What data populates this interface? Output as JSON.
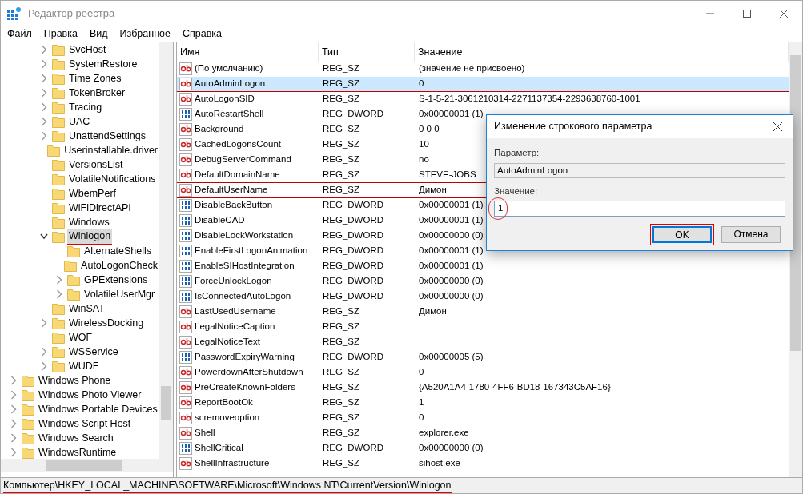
{
  "window": {
    "title": "Редактор реестра"
  },
  "menu": [
    "Файл",
    "Правка",
    "Вид",
    "Избранное",
    "Справка"
  ],
  "tree": {
    "items": [
      {
        "children": [
          {
            "children": [
              {
                "label": "SvcHost",
                "expandable": true,
                "expanded": false,
                "selected": false,
                "underlined": false
              },
              {
                "label": "SystemRestore",
                "expandable": true,
                "expanded": false,
                "selected": false,
                "underlined": false
              },
              {
                "label": "Time Zones",
                "expandable": true,
                "expanded": false,
                "selected": false,
                "underlined": false
              },
              {
                "label": "TokenBroker",
                "expandable": true,
                "expanded": false,
                "selected": false,
                "underlined": false
              },
              {
                "label": "Tracing",
                "expandable": true,
                "expanded": false,
                "selected": false,
                "underlined": false
              },
              {
                "label": "UAC",
                "expandable": true,
                "expanded": false,
                "selected": false,
                "underlined": false
              },
              {
                "label": "UnattendSettings",
                "expandable": true,
                "expanded": false,
                "selected": false,
                "underlined": false
              },
              {
                "label": "Userinstallable.driver",
                "expandable": false,
                "selected": false,
                "underlined": false
              },
              {
                "label": "VersionsList",
                "expandable": false,
                "selected": false,
                "underlined": false
              },
              {
                "label": "VolatileNotifications",
                "expandable": false,
                "selected": false,
                "underlined": false
              },
              {
                "label": "WbemPerf",
                "expandable": false,
                "selected": false,
                "underlined": false
              },
              {
                "label": "WiFiDirectAPI",
                "expandable": false,
                "selected": false,
                "underlined": false
              },
              {
                "label": "Windows",
                "expandable": false,
                "selected": false,
                "underlined": false
              },
              {
                "label": "Winlogon",
                "expandable": true,
                "expanded": true,
                "selected": true,
                "underlined": true,
                "children": [
                  {
                    "label": "AlternateShells",
                    "expandable": false,
                    "selected": false,
                    "underlined": false
                  },
                  {
                    "label": "AutoLogonCheck",
                    "expandable": false,
                    "selected": false,
                    "underlined": false
                  },
                  {
                    "label": "GPExtensions",
                    "expandable": true,
                    "expanded": false,
                    "selected": false,
                    "underlined": false
                  },
                  {
                    "label": "VolatileUserMgr",
                    "expandable": true,
                    "expanded": false,
                    "selected": false,
                    "underlined": false
                  }
                ]
              },
              {
                "label": "WinSAT",
                "expandable": false,
                "selected": false,
                "underlined": false
              },
              {
                "label": "WirelessDocking",
                "expandable": true,
                "expanded": false,
                "selected": false,
                "underlined": false
              },
              {
                "label": "WOF",
                "expandable": false,
                "selected": false,
                "underlined": false
              },
              {
                "label": "WSService",
                "expandable": true,
                "expanded": false,
                "selected": false,
                "underlined": false
              },
              {
                "label": "WUDF",
                "expandable": true,
                "expanded": false,
                "selected": false,
                "underlined": false
              }
            ]
          }
        ]
      },
      {
        "label": "Windows Phone",
        "expandable": true,
        "expanded": false,
        "selected": false,
        "underlined": false
      },
      {
        "label": "Windows Photo Viewer",
        "expandable": true,
        "expanded": false,
        "selected": false,
        "underlined": false
      },
      {
        "label": "Windows Portable Devices",
        "expandable": true,
        "expanded": false,
        "selected": false,
        "underlined": false
      },
      {
        "label": "Windows Script Host",
        "expandable": true,
        "expanded": false,
        "selected": false,
        "underlined": false
      },
      {
        "label": "Windows Search",
        "expandable": true,
        "expanded": false,
        "selected": false,
        "underlined": false
      },
      {
        "label": "WindowsRuntime",
        "expandable": true,
        "expanded": false,
        "selected": false,
        "underlined": false
      }
    ]
  },
  "table": {
    "columns": [
      "Имя",
      "Тип",
      "Значение"
    ],
    "rows": [
      {
        "kind": "string",
        "name": "(По умолчанию)",
        "type": "REG_SZ",
        "value": "(значение не присвоено)",
        "selected": false,
        "underlined": false
      },
      {
        "kind": "string",
        "name": "AutoAdminLogon",
        "type": "REG_SZ",
        "value": "0",
        "selected": true,
        "underlined": true
      },
      {
        "kind": "string",
        "name": "AutoLogonSID",
        "type": "REG_SZ",
        "value": "S-1-5-21-3061210314-2271137354-2293638760-1001",
        "selected": false,
        "underlined": false
      },
      {
        "kind": "binary",
        "name": "AutoRestartShell",
        "type": "REG_DWORD",
        "value": "0x00000001 (1)",
        "selected": false,
        "underlined": false
      },
      {
        "kind": "string",
        "name": "Background",
        "type": "REG_SZ",
        "value": "0 0 0",
        "selected": false,
        "underlined": false
      },
      {
        "kind": "string",
        "name": "CachedLogonsCount",
        "type": "REG_SZ",
        "value": "10",
        "selected": false,
        "underlined": false
      },
      {
        "kind": "string",
        "name": "DebugServerCommand",
        "type": "REG_SZ",
        "value": "no",
        "selected": false,
        "underlined": false
      },
      {
        "kind": "string",
        "name": "DefaultDomainName",
        "type": "REG_SZ",
        "value": "STEVE-JOBS",
        "selected": false,
        "underlined": true
      },
      {
        "kind": "string",
        "name": "DefaultUserName",
        "type": "REG_SZ",
        "value": "Димон",
        "selected": false,
        "underlined": true
      },
      {
        "kind": "binary",
        "name": "DisableBackButton",
        "type": "REG_DWORD",
        "value": "0x00000001 (1)",
        "selected": false,
        "underlined": false
      },
      {
        "kind": "binary",
        "name": "DisableCAD",
        "type": "REG_DWORD",
        "value": "0x00000001 (1)",
        "selected": false,
        "underlined": false
      },
      {
        "kind": "binary",
        "name": "DisableLockWorkstation",
        "type": "REG_DWORD",
        "value": "0x00000000 (0)",
        "selected": false,
        "underlined": false
      },
      {
        "kind": "binary",
        "name": "EnableFirstLogonAnimation",
        "type": "REG_DWORD",
        "value": "0x00000001 (1)",
        "selected": false,
        "underlined": false
      },
      {
        "kind": "binary",
        "name": "EnableSIHostIntegration",
        "type": "REG_DWORD",
        "value": "0x00000001 (1)",
        "selected": false,
        "underlined": false
      },
      {
        "kind": "binary",
        "name": "ForceUnlockLogon",
        "type": "REG_DWORD",
        "value": "0x00000000 (0)",
        "selected": false,
        "underlined": false
      },
      {
        "kind": "binary",
        "name": "IsConnectedAutoLogon",
        "type": "REG_DWORD",
        "value": "0x00000000 (0)",
        "selected": false,
        "underlined": false
      },
      {
        "kind": "string",
        "name": "LastUsedUsername",
        "type": "REG_SZ",
        "value": "Димон",
        "selected": false,
        "underlined": false
      },
      {
        "kind": "string",
        "name": "LegalNoticeCaption",
        "type": "REG_SZ",
        "selected": false,
        "underlined": false
      },
      {
        "kind": "string",
        "name": "LegalNoticeText",
        "type": "REG_SZ",
        "selected": false,
        "underlined": false
      },
      {
        "kind": "binary",
        "name": "PasswordExpiryWarning",
        "type": "REG_DWORD",
        "value": "0x00000005 (5)",
        "selected": false,
        "underlined": false
      },
      {
        "kind": "string",
        "name": "PowerdownAfterShutdown",
        "type": "REG_SZ",
        "value": "0",
        "selected": false,
        "underlined": false
      },
      {
        "kind": "string",
        "name": "PreCreateKnownFolders",
        "type": "REG_SZ",
        "value": "{A520A1A4-1780-4FF6-BD18-167343C5AF16}",
        "selected": false,
        "underlined": false
      },
      {
        "kind": "string",
        "name": "ReportBootOk",
        "type": "REG_SZ",
        "value": "1",
        "selected": false,
        "underlined": false
      },
      {
        "kind": "string",
        "name": "scremoveoption",
        "type": "REG_SZ",
        "value": "0",
        "selected": false,
        "underlined": false
      },
      {
        "kind": "string",
        "name": "Shell",
        "type": "REG_SZ",
        "value": "explorer.exe",
        "selected": false,
        "underlined": false
      },
      {
        "kind": "binary",
        "name": "ShellCritical",
        "type": "REG_DWORD",
        "value": "0x00000000 (0)",
        "selected": false,
        "underlined": false
      },
      {
        "kind": "string",
        "name": "ShellInfrastructure",
        "type": "REG_SZ",
        "value": "sihost.exe",
        "selected": false,
        "underlined": false
      }
    ]
  },
  "status_bar": {
    "path": "Компьютер\\HKEY_LOCAL_MACHINE\\SOFTWARE\\Microsoft\\Windows NT\\CurrentVersion\\Winlogon",
    "underlined": true
  },
  "dialog": {
    "title": "Изменение строкового параметра",
    "name_label": "Параметр:",
    "name_value": "AutoAdminLogon",
    "value_label": "Значение:",
    "value": "1",
    "value_circled": true,
    "buttons": [
      {
        "label": "OK",
        "default": true,
        "boxed": true
      },
      {
        "label": "Отмена",
        "default": false,
        "boxed": false
      }
    ]
  }
}
